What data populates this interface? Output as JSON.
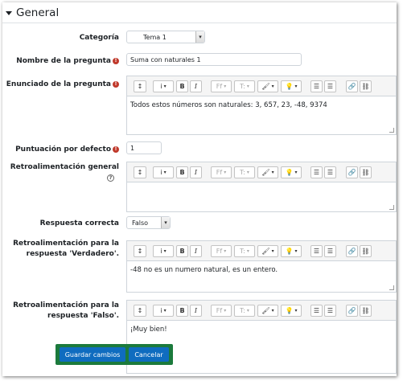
{
  "section": {
    "title": "General"
  },
  "fields": {
    "category": {
      "label": "Categoría",
      "value": "Tema 1"
    },
    "question_name": {
      "label": "Nombre de la pregunta",
      "value": "Suma con naturales 1"
    },
    "question_text": {
      "label": "Enunciado de la pregunta",
      "content": "Todos estos números son naturales: 3, 657, 23, -48, 9374"
    },
    "default_mark": {
      "label": "Puntuación por defecto",
      "value": "1"
    },
    "general_feedback": {
      "label": "Retroalimentación general",
      "content": ""
    },
    "correct_answer": {
      "label": "Respuesta correcta",
      "value": "Falso"
    },
    "feedback_true": {
      "label_line1": "Retroalimentación para la",
      "label_line2": "respuesta 'Verdadero'.",
      "content": "-48 no es un numero natural, es un entero."
    },
    "feedback_false": {
      "label_line1": "Retroalimentación para la",
      "label_line2": "respuesta 'Falso'.",
      "content": "¡Muy bien!"
    }
  },
  "icons": {
    "required": "!",
    "help": "?",
    "toolbar": [
      "collapse-icon",
      "info-icon",
      "bold-icon",
      "italic-icon",
      "font-family-icon",
      "font-size-icon",
      "font-color-icon",
      "highlight-icon",
      "bullet-list-icon",
      "numbered-list-icon",
      "link-icon",
      "unlink-icon"
    ]
  },
  "toolbar_labels": {
    "collapse": "↕",
    "info": "i",
    "bold": "B",
    "italic": "I",
    "font_family": "Ff",
    "font_size": "T:",
    "font_color": "🖌",
    "highlight": "💡",
    "bullets": "☰",
    "numbers": "☰",
    "link": "🔗",
    "unlink": "⛓"
  },
  "buttons": {
    "save": "Guardar cambios",
    "cancel": "Cancelar"
  },
  "colors": {
    "primary": "#0f6cbf",
    "highlight_box": "#1b7a3c",
    "required": "#c0392b"
  }
}
